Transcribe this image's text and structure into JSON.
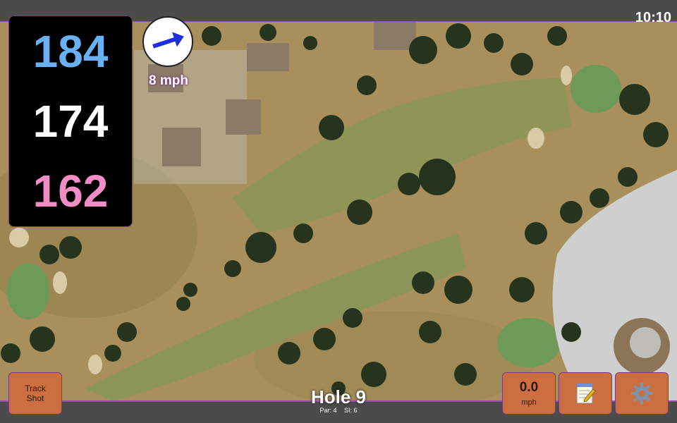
{
  "status_bar": {
    "time": "10:10"
  },
  "distances": {
    "back": "184",
    "middle": "174",
    "front": "162",
    "colors": {
      "back": "#6ab0f5",
      "middle": "#ffffff",
      "front": "#f28cc5"
    }
  },
  "wind": {
    "speed_label": "8 mph",
    "direction_icon": "arrow-right-icon"
  },
  "buttons": {
    "track_shot_line1": "Track",
    "track_shot_line2": "Shot",
    "speed_value": "0.0",
    "speed_unit": "mph",
    "notes_icon": "notepad-icon",
    "settings_icon": "gear-icon"
  },
  "hole": {
    "title": "Hole 9",
    "par": "Par: 4",
    "si": "SI: 6"
  },
  "colors": {
    "button": "#cc6e3f",
    "accent": "#9a4fa8",
    "wind_text": "#ffffff"
  }
}
